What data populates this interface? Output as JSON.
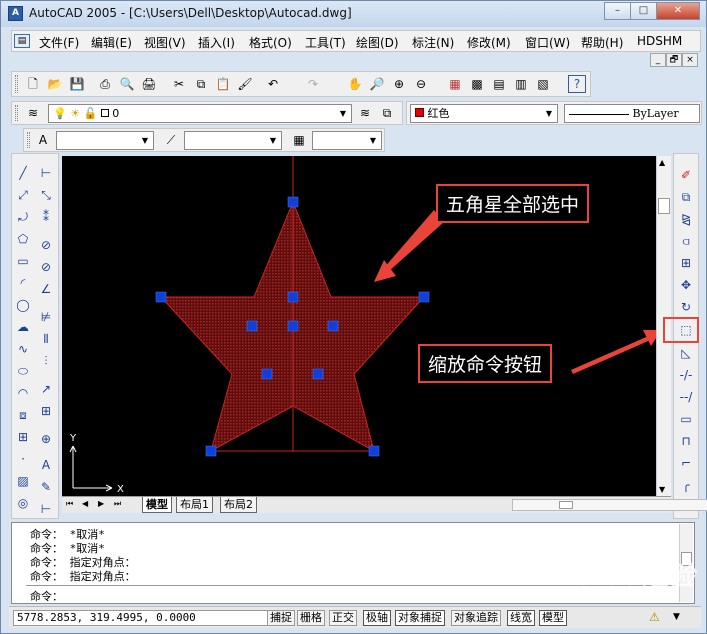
{
  "window": {
    "title": "AutoCAD 2005 - [C:\\Users\\Dell\\Desktop\\Autocad.dwg]",
    "app_icon": "autocad-app-icon",
    "controls": [
      "–",
      "□",
      "✕"
    ],
    "inner_controls": [
      "_",
      "🗗",
      "×"
    ]
  },
  "menu": [
    "文件(F)",
    "编辑(E)",
    "视图(V)",
    "插入(I)",
    "格式(O)",
    "工具(T)",
    "绘图(D)",
    "标注(N)",
    "修改(M)",
    "窗口(W)",
    "帮助(H)",
    "HDSHM"
  ],
  "layers": {
    "current_layer": "0",
    "color": "红色",
    "color_hex": "#e00000",
    "linetype": "ByLayer"
  },
  "tabs": [
    "模型",
    "布局1",
    "布局2"
  ],
  "command_history": [
    "命令： *取消*",
    "命令： *取消*",
    "命令： 指定对角点：",
    "命令： 指定对角点："
  ],
  "command_prompt": "命令：",
  "status": {
    "coords": "5778.2853, 319.4995, 0.0000",
    "buttons": [
      "捕捉",
      "栅格",
      "正交",
      "极轴",
      "对象捕捉",
      "对象追踪",
      "线宽",
      "模型"
    ],
    "active_buttons": [
      "极轴",
      "对象捕捉",
      "线宽",
      "模型"
    ]
  },
  "annotations": {
    "star_label": "五角星全部选中",
    "zoom_label": "缩放命令按钮"
  },
  "ucs": {
    "x_label": "X",
    "y_label": "Y"
  },
  "watermark": "Baidu经验",
  "colors": {
    "star_fill": "#8b1a1a",
    "grip": "#1040d8",
    "annotation": "#e8443a",
    "canvas": "#000000"
  }
}
